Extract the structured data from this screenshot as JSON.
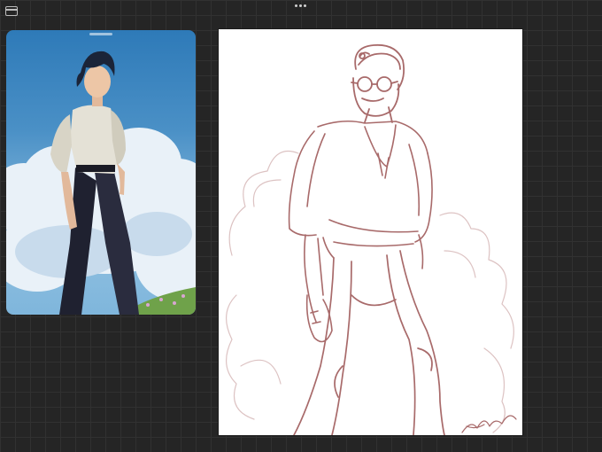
{
  "toolbar": {
    "gallery_icon": "gallery-icon",
    "more_icon": "more-options-icon"
  },
  "reference_panel": {
    "image": "character-reference-photo"
  },
  "canvas": {
    "sketch": "character-sketch",
    "stroke_color": "#a86a6a"
  }
}
